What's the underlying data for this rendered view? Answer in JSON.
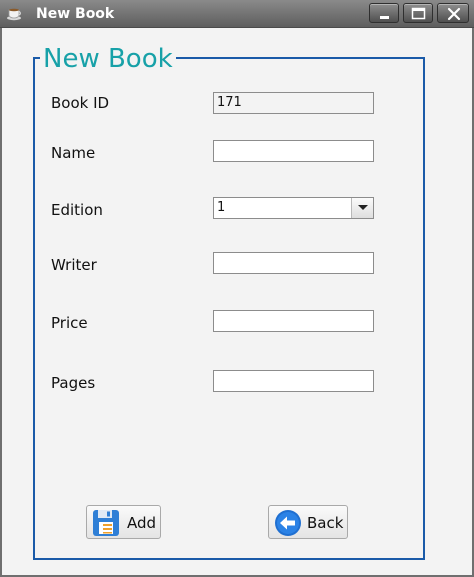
{
  "window": {
    "title": "New Book",
    "controls": {
      "minimize": "minimize-icon",
      "maximize": "maximize-icon",
      "close": "close-icon"
    }
  },
  "form": {
    "group_title": "New Book",
    "fields": [
      {
        "label": "Book ID",
        "value": "171",
        "editable": false
      },
      {
        "label": "Name",
        "value": ""
      },
      {
        "label": "Edition",
        "value": "1",
        "type": "select"
      },
      {
        "label": "Writer",
        "value": ""
      },
      {
        "label": "Price",
        "value": ""
      },
      {
        "label": "Pages",
        "value": ""
      }
    ]
  },
  "buttons": {
    "add": {
      "label": "Add",
      "icon": "save-icon"
    },
    "back": {
      "label": "Back",
      "icon": "back-arrow-icon"
    }
  },
  "colors": {
    "group_border": "#1a5aa8",
    "group_title": "#17a1a8",
    "background": "#f3f3f3"
  }
}
